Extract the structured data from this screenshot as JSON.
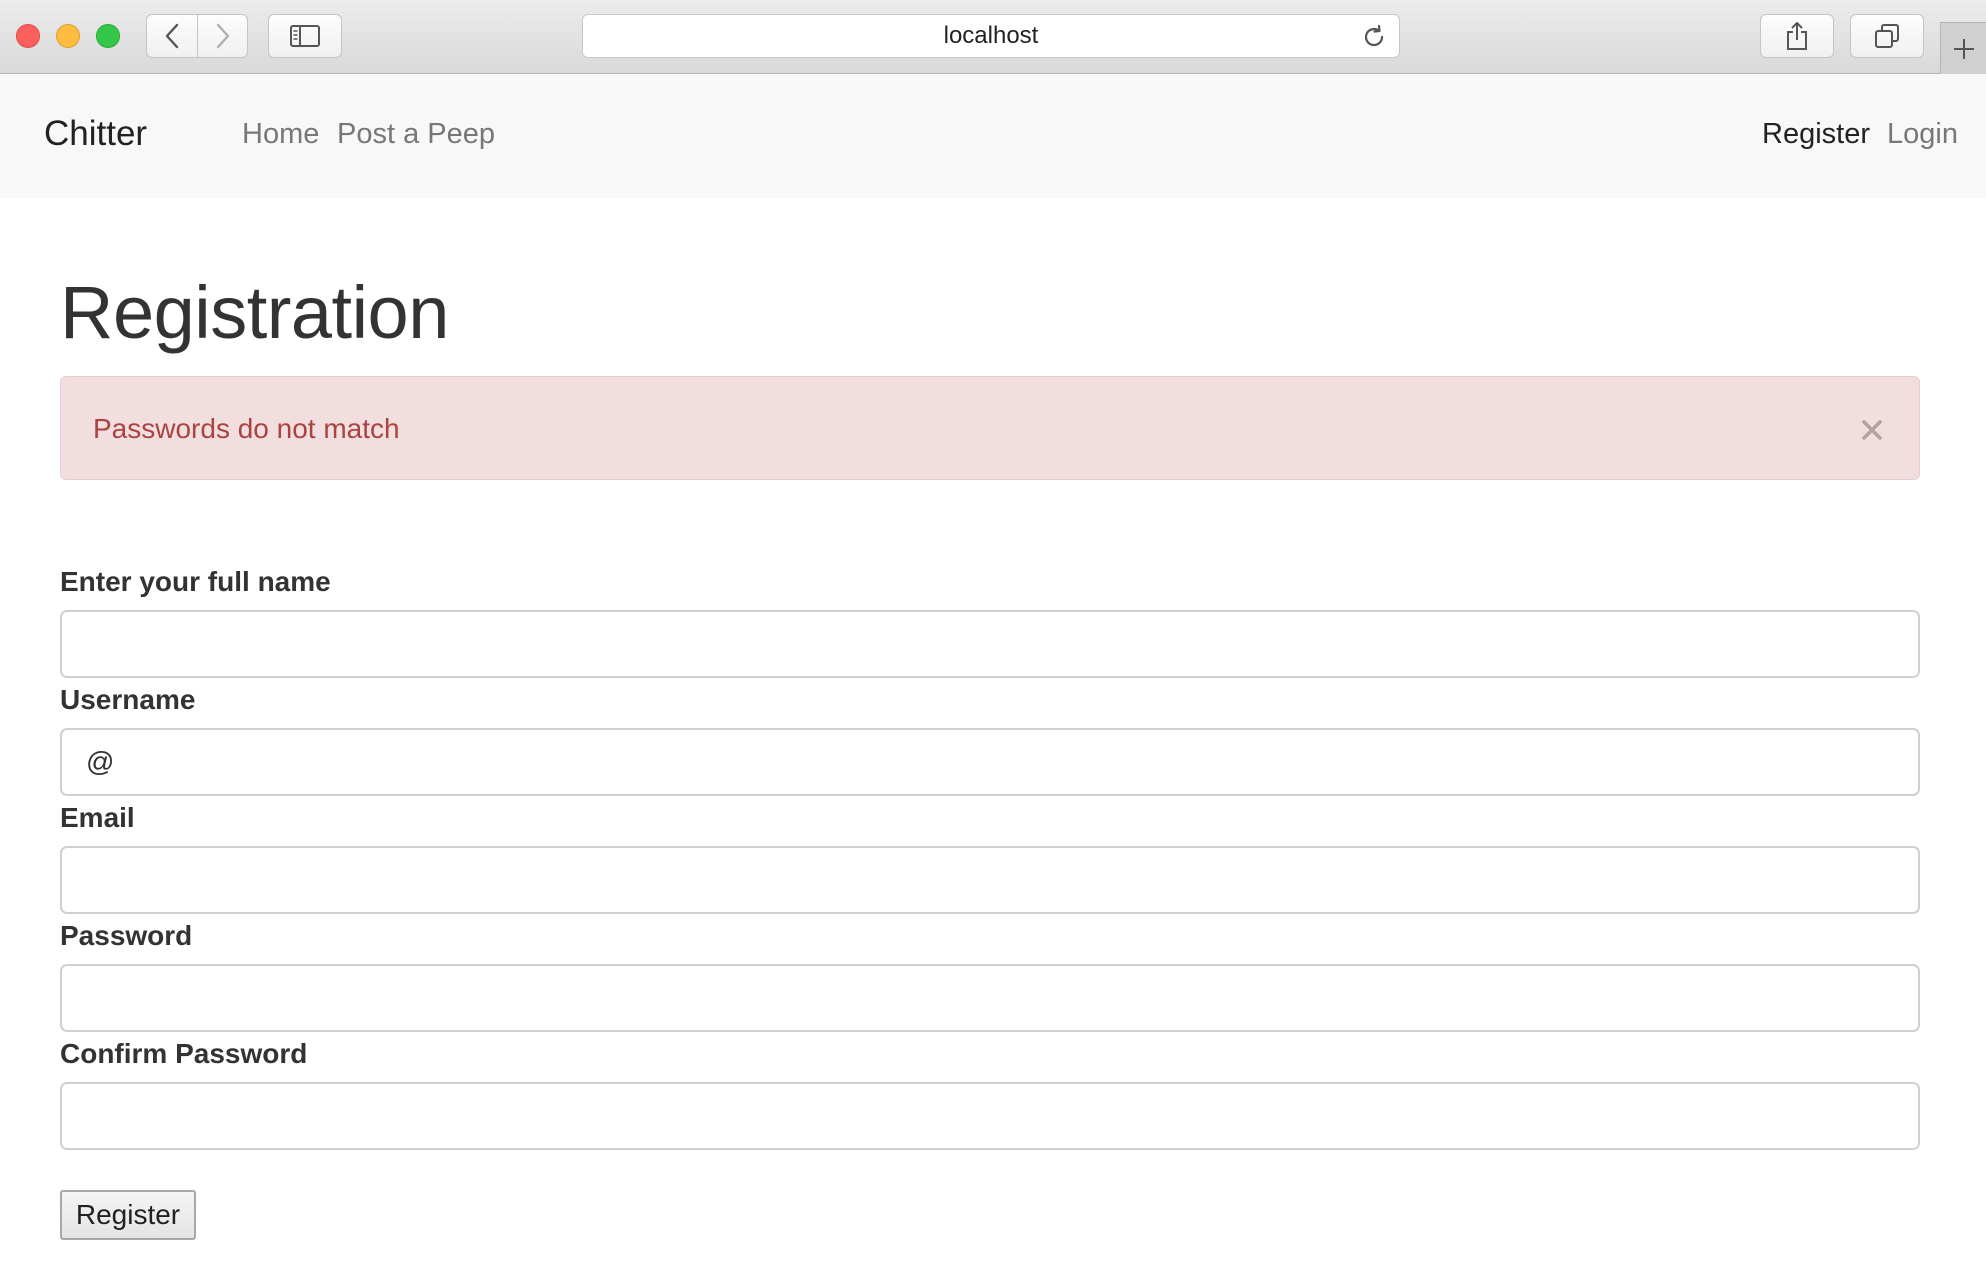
{
  "browser": {
    "url": "localhost"
  },
  "navbar": {
    "brand": "Chitter",
    "links": [
      {
        "label": "Home"
      },
      {
        "label": "Post a Peep"
      }
    ],
    "right_links": [
      {
        "label": "Register",
        "active": true
      },
      {
        "label": "Login",
        "active": false
      }
    ]
  },
  "page": {
    "title": "Registration",
    "alert": {
      "message": "Passwords do not match",
      "close_symbol": "×",
      "color": "#a94442",
      "background": "#f2dede"
    }
  },
  "form": {
    "fields": [
      {
        "label": "Enter your full name",
        "value": "",
        "placeholder": ""
      },
      {
        "label": "Username",
        "value": "",
        "placeholder": "@"
      },
      {
        "label": "Email",
        "value": "",
        "placeholder": ""
      },
      {
        "label": "Password",
        "value": "",
        "placeholder": ""
      },
      {
        "label": "Confirm Password",
        "value": "",
        "placeholder": ""
      }
    ],
    "submit_label": "Register"
  }
}
